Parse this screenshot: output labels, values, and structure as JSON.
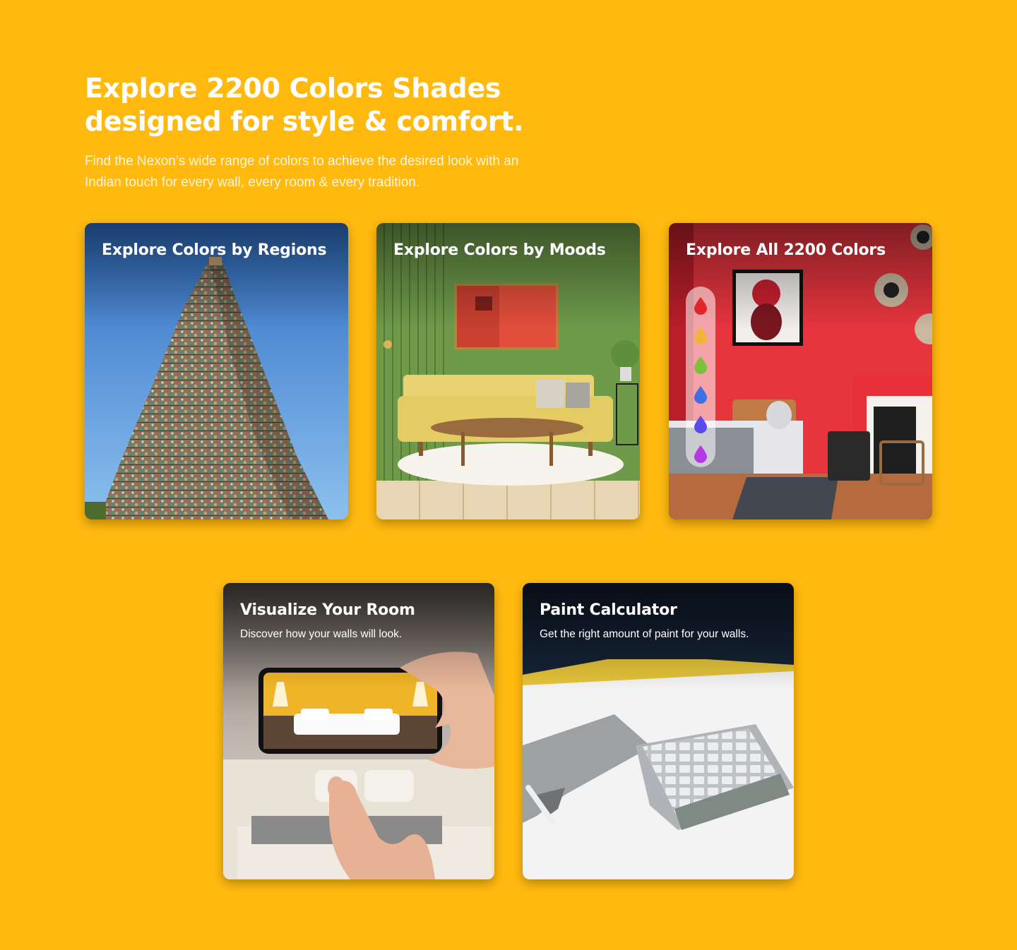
{
  "hero": {
    "title_line1": "Explore 2200 Colors Shades",
    "title_line2": "designed for style & comfort.",
    "description": "Find the Nexon’s wide range of colors to achieve the desired look with an Indian touch for every wall, every room & every tradition."
  },
  "cards": [
    {
      "title": "Explore Colors by Regions"
    },
    {
      "title": "Explore Colors by Moods"
    },
    {
      "title": "Explore All 2200 Colors",
      "drop_colors": [
        "#E0262A",
        "#F2B33D",
        "#7BC23A",
        "#3F6FE0",
        "#5A4BEA",
        "#B43AE6"
      ]
    },
    {
      "title": "Visualize Your Room",
      "subtitle": "Discover how your walls will look."
    },
    {
      "title": "Paint Calculator",
      "subtitle": "Get the right amount of paint for your walls."
    }
  ],
  "colors": {
    "background": "#FFB90F",
    "text": "#FFFFFF"
  }
}
